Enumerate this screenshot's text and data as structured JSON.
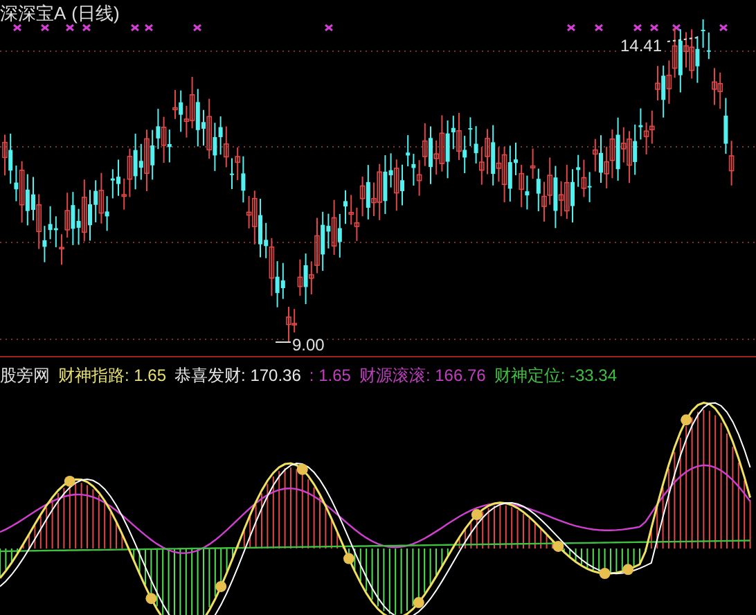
{
  "title": "深深宝A",
  "period": "(日线)",
  "high_label": "14.41",
  "low_label": "9.00",
  "indicator": {
    "name": "股旁网",
    "values": [
      {
        "text": "财神指路: 1.65",
        "color": "#e8e070"
      },
      {
        "text": "恭喜发财: 170.36",
        "color": "#e8e8e8"
      },
      {
        "text": ": 1.65",
        "color": "#c040c0"
      },
      {
        "text": "财源滚滚: 166.76",
        "color": "#c040c0"
      },
      {
        "text": "财神定位: -33.34",
        "color": "#40c040"
      }
    ]
  }
}
